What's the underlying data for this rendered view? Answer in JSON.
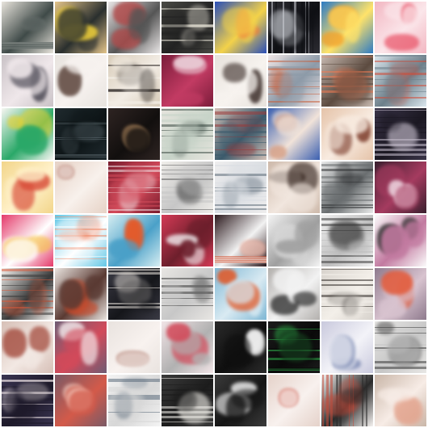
{
  "grid": {
    "rows": 8,
    "cols": 8,
    "tiles": [
      {
        "bg": "#e8e4dc",
        "fg": "#8a8f8c",
        "acc": "#3f4a48",
        "pattern": "stripes"
      },
      {
        "bg": "#e3c48a",
        "fg": "#f2d23a",
        "acc": "#2a2f2e",
        "pattern": "blob"
      },
      {
        "bg": "#e9e6e6",
        "fg": "#b24a4a",
        "acc": "#555555",
        "pattern": "blob"
      },
      {
        "bg": "#4a4a45",
        "fg": "#e6e2d6",
        "acc": "#222222",
        "pattern": "stripes"
      },
      {
        "bg": "#2a4fb8",
        "fg": "#f07a3a",
        "acc": "#f3d24a",
        "pattern": "blob"
      },
      {
        "bg": "#2c2c32",
        "fg": "#cfd2d8",
        "acc": "#0f1014",
        "pattern": "vbars"
      },
      {
        "bg": "#2d7bc4",
        "fg": "#f0a02c",
        "acc": "#ffe36a",
        "pattern": "blob"
      },
      {
        "bg": "#f2b7c2",
        "fg": "#e8445a",
        "acc": "#fbe6ea",
        "pattern": "blob"
      },
      {
        "bg": "#c9c2c6",
        "fg": "#3c3a46",
        "acc": "#efe7ea",
        "pattern": "blob"
      },
      {
        "bg": "#e7e3de",
        "fg": "#6f5a52",
        "acc": "#f7f2ef",
        "pattern": "blob"
      },
      {
        "bg": "#d7cbb8",
        "fg": "#2a2522",
        "acc": "#f2ece4",
        "pattern": "stripes"
      },
      {
        "bg": "#7b1c3a",
        "fg": "#f3f0f2",
        "acc": "#c23b63",
        "pattern": "blob"
      },
      {
        "bg": "#e7e2dc",
        "fg": "#3a2c28",
        "acc": "#f7f3ef",
        "pattern": "blob"
      },
      {
        "bg": "#efe6e6",
        "fg": "#c85f3b",
        "acc": "#8d9aa8",
        "pattern": "stripes"
      },
      {
        "bg": "#c7b9b0",
        "fg": "#f07a52",
        "acc": "#5c4b40",
        "pattern": "stripes"
      },
      {
        "bg": "#dbe7ee",
        "fg": "#d34a36",
        "acc": "#6d7f8a",
        "pattern": "stripes"
      },
      {
        "bg": "#f7f6f2",
        "fg": "#e8d22f",
        "acc": "#2aa868",
        "pattern": "blob"
      },
      {
        "bg": "#1f2a2e",
        "fg": "#5c6a70",
        "acc": "#0d1416",
        "pattern": "stripes"
      },
      {
        "bg": "#2e2422",
        "fg": "#c79a6b",
        "acc": "#120f0e",
        "pattern": "blob"
      },
      {
        "bg": "#e7e5de",
        "fg": "#3c4a44",
        "acc": "#c7d3c8",
        "pattern": "stripes"
      },
      {
        "bg": "#d3c0b7",
        "fg": "#9d3a3a",
        "acc": "#3b5a6b",
        "pattern": "stripes"
      },
      {
        "bg": "#3a5fb0",
        "fg": "#d7a38a",
        "acc": "#f1e3d9",
        "pattern": "blob"
      },
      {
        "bg": "#e5c3a9",
        "fg": "#7c3c2b",
        "acc": "#f8ebe0",
        "pattern": "blob"
      },
      {
        "bg": "#3a3448",
        "fg": "#c9c1d0",
        "acc": "#1b1822",
        "pattern": "stripes"
      },
      {
        "bg": "#f2d58a",
        "fg": "#d94e3a",
        "acc": "#fff1c9",
        "pattern": "blob"
      },
      {
        "bg": "#e6d2c6",
        "fg": "#a35a4a",
        "acc": "#f8f1ec",
        "pattern": "blob"
      },
      {
        "bg": "#7a1c2d",
        "fg": "#f2e8ea",
        "acc": "#d24a5a",
        "pattern": "stripes"
      },
      {
        "bg": "#f0eeea",
        "fg": "#5a5a5a",
        "acc": "#c6c6c6",
        "pattern": "stripes"
      },
      {
        "bg": "#efeeee",
        "fg": "#5d6b78",
        "acc": "#d9dde2",
        "pattern": "stripes"
      },
      {
        "bg": "#cdb9aa",
        "fg": "#2c1c16",
        "acc": "#f1e6de",
        "pattern": "blob"
      },
      {
        "bg": "#e9eaea",
        "fg": "#2f3133",
        "acc": "#6a6e70",
        "pattern": "stripes"
      },
      {
        "bg": "#3a1f2e",
        "fg": "#f6e6ee",
        "acc": "#a53b5f",
        "pattern": "blob"
      },
      {
        "bg": "#e43a6a",
        "fg": "#f6c24a",
        "acc": "#ffffff",
        "pattern": "blob"
      },
      {
        "bg": "#63c7e6",
        "fg": "#f08a6a",
        "acc": "#ffffff",
        "pattern": "stripes"
      },
      {
        "bg": "#d7eef2",
        "fg": "#e45a2a",
        "acc": "#4aa0c8",
        "pattern": "blob"
      },
      {
        "bg": "#d43a55",
        "fg": "#f2eef0",
        "acc": "#6d1f2c",
        "pattern": "blob"
      },
      {
        "bg": "#2c1a1e",
        "fg": "#d35a3a",
        "acc": "#f2f2f2",
        "pattern": "stripes"
      },
      {
        "bg": "#f4f4f4",
        "fg": "#d7d7d7",
        "acc": "#9f9f9f",
        "pattern": "blob"
      },
      {
        "bg": "#f0f0f0",
        "fg": "#3a3a3a",
        "acc": "#bdbdbd",
        "pattern": "stripes"
      },
      {
        "bg": "#fbfbfb",
        "fg": "#2a2a2a",
        "acc": "#c27aa0",
        "pattern": "blob"
      },
      {
        "bg": "#f6f3f0",
        "fg": "#d85a3a",
        "acc": "#3a3a3a",
        "pattern": "stripes"
      },
      {
        "bg": "#e9e3de",
        "fg": "#cc4a2a",
        "acc": "#5a3a33",
        "pattern": "blob"
      },
      {
        "bg": "#3a3a44",
        "fg": "#e9e3dd",
        "acc": "#15161a",
        "pattern": "stripes"
      },
      {
        "bg": "#e8e6e3",
        "fg": "#3a3a3a",
        "acc": "#c7c7c7",
        "pattern": "stripes"
      },
      {
        "bg": "#7fb7d4",
        "fg": "#e05a2a",
        "acc": "#d9eaf2",
        "pattern": "blob"
      },
      {
        "bg": "#b3b0ad",
        "fg": "#2a2a2a",
        "acc": "#f2f2f2",
        "pattern": "blob"
      },
      {
        "bg": "#d7d2cc",
        "fg": "#2f2a27",
        "acc": "#f3efe9",
        "pattern": "stripes"
      },
      {
        "bg": "#8e7a8d",
        "fg": "#e35a3a",
        "acc": "#d8c3cf",
        "pattern": "blob"
      },
      {
        "bg": "#d7c0b7",
        "fg": "#a2483a",
        "acc": "#f2e8e3",
        "pattern": "blob"
      },
      {
        "bg": "#6f5c73",
        "fg": "#f2e8ea",
        "acc": "#d24a5a",
        "pattern": "blob"
      },
      {
        "bg": "#e9e3df",
        "fg": "#9a5a4a",
        "acc": "#f8f2ef",
        "pattern": "blob"
      },
      {
        "bg": "#f1e4e6",
        "fg": "#d34a5a",
        "acc": "#b1b1b1",
        "pattern": "blob"
      },
      {
        "bg": "#2a2a2a",
        "fg": "#f2f2f2",
        "acc": "#0f0f0f",
        "pattern": "blob"
      },
      {
        "bg": "#1b1b1b",
        "fg": "#2fae4a",
        "acc": "#0a0a0a",
        "pattern": "stripes"
      },
      {
        "bg": "#c9c9dd",
        "fg": "#6a7aa8",
        "acc": "#f3f3f8",
        "pattern": "blob"
      },
      {
        "bg": "#e8e7e5",
        "fg": "#3a3a3a",
        "acc": "#c7c7c7",
        "pattern": "stripes"
      },
      {
        "bg": "#3a3552",
        "fg": "#f2e8ea",
        "acc": "#1e1a2a",
        "pattern": "stripes"
      },
      {
        "bg": "#7a5a66",
        "fg": "#f4d2c6",
        "acc": "#d35a4a",
        "pattern": "blob"
      },
      {
        "bg": "#f3f3f3",
        "fg": "#5a6a7a",
        "acc": "#d7d7d7",
        "pattern": "stripes"
      },
      {
        "bg": "#3a3a3a",
        "fg": "#f1efe9",
        "acc": "#1c1c1c",
        "pattern": "stripes"
      },
      {
        "bg": "#3a3a3a",
        "fg": "#f5f5f5",
        "acc": "#151515",
        "pattern": "blob"
      },
      {
        "bg": "#e5d2ca",
        "fg": "#c84a3a",
        "acc": "#f8f1ee",
        "pattern": "blob"
      },
      {
        "bg": "#f5f2f0",
        "fg": "#c34a3a",
        "acc": "#2a2a2a",
        "pattern": "vbars"
      },
      {
        "bg": "#c9b6a8",
        "fg": "#e3a18a",
        "acc": "#f7ece6",
        "pattern": "blob"
      }
    ]
  }
}
